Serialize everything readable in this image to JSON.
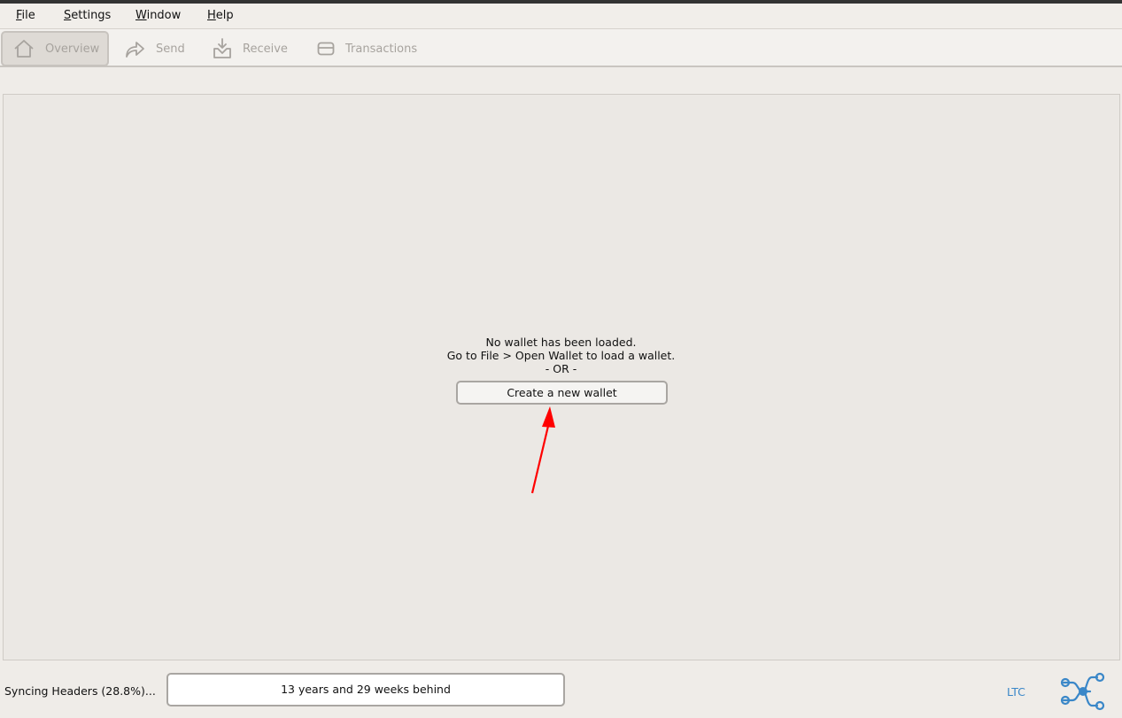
{
  "menu": {
    "file": {
      "accel": "F",
      "rest": "ile"
    },
    "settings": {
      "accel": "S",
      "rest": "ettings"
    },
    "window": {
      "accel": "W",
      "rest": "indow"
    },
    "help": {
      "accel": "H",
      "rest": "elp"
    }
  },
  "tabs": [
    {
      "label": "Overview",
      "icon": "home-icon"
    },
    {
      "label": "Send",
      "icon": "send-arrow-icon"
    },
    {
      "label": "Receive",
      "icon": "inbox-tray-icon"
    },
    {
      "label": "Transactions",
      "icon": "card-icon"
    }
  ],
  "main": {
    "line1": "No wallet has been loaded.",
    "line2": "Go to File > Open Wallet to load a wallet.",
    "line3": "- OR -",
    "create_button": "Create a new wallet"
  },
  "status": {
    "sync_text": "Syncing Headers (28.8%)...",
    "progress_text": "13 years and 29 weeks behind",
    "unit": "LTC"
  },
  "colors": {
    "accent_link": "#3a87c8",
    "annotation_arrow": "#ff0000"
  }
}
